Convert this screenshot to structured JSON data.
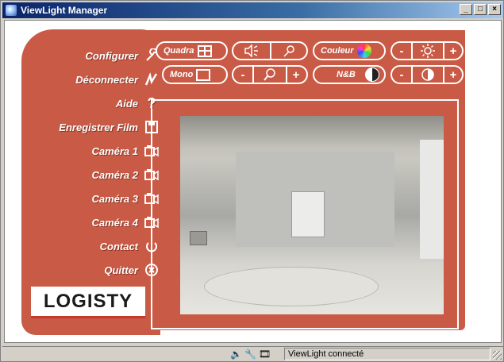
{
  "window": {
    "title": "ViewLight Manager",
    "controls": {
      "minimize": "_",
      "maximize": "□",
      "close": "×"
    }
  },
  "sidebar": {
    "items": [
      {
        "label": "Configurer",
        "icon": "wrench-icon",
        "glyph": "🔧"
      },
      {
        "label": "Déconnecter",
        "icon": "disconnect-icon",
        "glyph": "≁"
      },
      {
        "label": "Aide",
        "icon": "help-icon",
        "glyph": "?"
      },
      {
        "label": "Enregistrer Film",
        "icon": "save-film-icon",
        "glyph": "💾"
      },
      {
        "label": "Caméra 1",
        "icon": "camera-icon",
        "glyph": "📹"
      },
      {
        "label": "Caméra 2",
        "icon": "camera-icon",
        "glyph": "📹"
      },
      {
        "label": "Caméra 3",
        "icon": "camera-icon",
        "glyph": "📹"
      },
      {
        "label": "Caméra 4",
        "icon": "camera-icon",
        "glyph": "📹"
      },
      {
        "label": "Contact",
        "icon": "power-icon",
        "glyph": "⏻"
      },
      {
        "label": "Quitter",
        "icon": "close-circle-icon",
        "glyph": "⊗"
      }
    ],
    "logo": "LOGISTY"
  },
  "toolbar": {
    "quadra": "Quadra",
    "mono": "Mono",
    "couleur": "Couleur",
    "nb": "N&B",
    "minus": "-",
    "plus": "+"
  },
  "colors": {
    "panel": "#c95a45",
    "title_start": "#0a246a",
    "title_end": "#a6caf0"
  },
  "statusbar": {
    "text": "ViewLight connecté"
  }
}
